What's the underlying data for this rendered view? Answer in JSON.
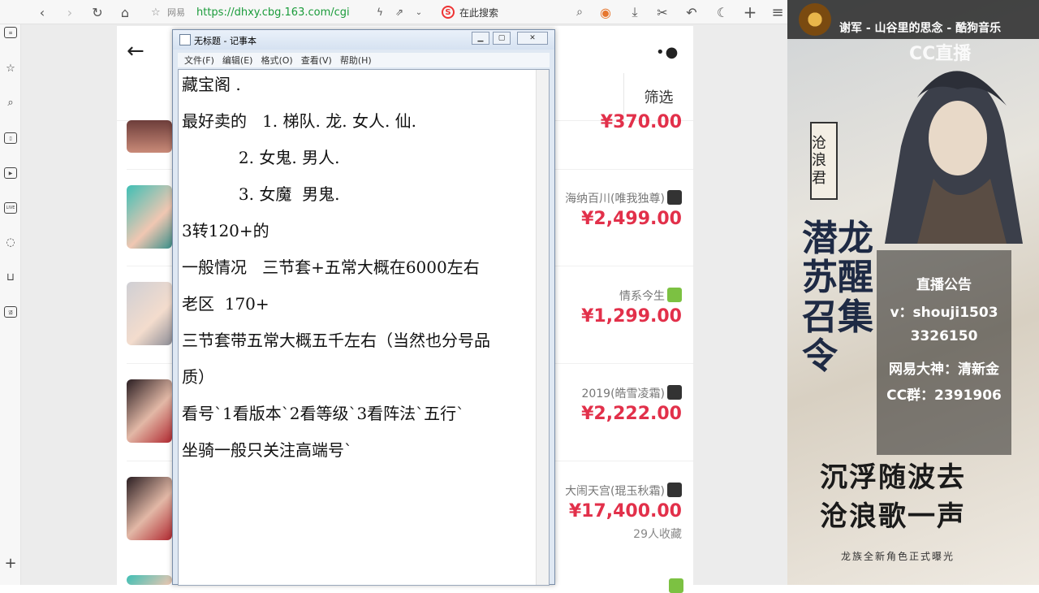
{
  "browser": {
    "site_name": "网易",
    "url": "https://dhxy.cbg.163.com/cgi",
    "search_placeholder": "在此搜索"
  },
  "page": {
    "filter_label": "筛选",
    "partial_price_top": "¥370.00",
    "items": [
      {
        "name": "海纳百川(唯我独尊)",
        "os": "ios",
        "price": "¥2,499.00",
        "fav": ""
      },
      {
        "name": "情系今生",
        "os": "android",
        "price": "¥1,299.00",
        "fav": ""
      },
      {
        "name": "2019(皓雪凌霜)",
        "os": "ios",
        "price": "¥2,222.00",
        "fav": ""
      },
      {
        "name": "大闹天宫(琨玉秋霜)",
        "os": "ios",
        "price": "¥17,400.00",
        "fav": "29人收藏"
      }
    ]
  },
  "notepad": {
    "title": "无标题 - 记事本",
    "menu": [
      "文件(F)",
      "编辑(E)",
      "格式(O)",
      "查看(V)",
      "帮助(H)"
    ],
    "lines": [
      "藏宝阁 .",
      "最好卖的   1. 梯队. 龙. 女人. 仙.",
      "           2. 女鬼. 男人.",
      "           3. 女魔  男鬼.",
      "3转120+的",
      "一般情况   三节套+五常大概在6000左右",
      "老区  170+",
      "三节套带五常大概五千左右（当然也分号品",
      "质）",
      "看号`1看版本`2看等级`3看阵法`五行`",
      "坐骑一般只关注高端号`"
    ]
  },
  "stream": {
    "song": "谢军 - 山谷里的思念 - 酷狗音乐",
    "platform": "CC直播",
    "tag": "沧浪君",
    "big_text": "潜龙苏醒召集令",
    "notice_title": "直播公告",
    "notice_lines": [
      "v：shouji1503",
      "3326150",
      "网易大神：清新金",
      "CC群：2391906"
    ],
    "bottom_line1": "沉浮随波去",
    "bottom_line2": "沧浪歌一声",
    "bottom_line3": "龙族全新角色正式曝光"
  }
}
